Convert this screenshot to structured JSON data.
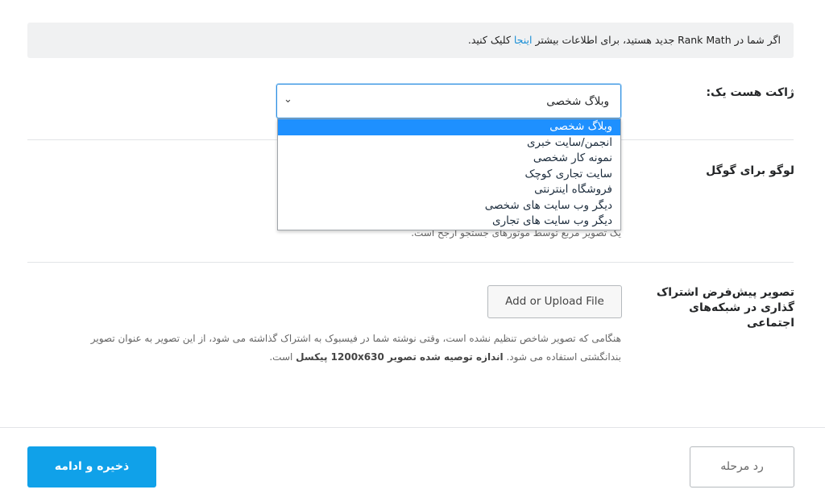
{
  "notice": {
    "before": "اگر شما در Rank Math جدید هستید، برای اطلاعات بیشتر ",
    "link": "اینجا",
    "after": " کلیک کنید."
  },
  "site_type": {
    "label": "ژاکت هست یک:",
    "selected": "وبلاگ شخصی",
    "options": [
      "وبلاگ شخصی",
      "انجمن/سایت خبری",
      "نمونه کار شخصی",
      "سایت تجاری کوچک",
      "فروشگاه اینترنتی",
      "دیگر وب سایت های شخصی",
      "دیگر وب سایت های تجاری"
    ]
  },
  "logo": {
    "label": "لوگو برای گوگل",
    "desc": "یک تصویر مربع توسط موتورهای جستجو ارجح است."
  },
  "social": {
    "label": "تصویر پیش‌فرض اشتراک گذاری در شبکه‌های اجتماعی",
    "button": "Add or Upload File",
    "desc_1": "هنگامی که تصویر شاخص تنظیم نشده است، وقتی نوشته شما در فیسبوک به اشتراک گذاشته می شود، از این تصویر به عنوان تصویر بندانگشتی استفاده می شود. ",
    "desc_bold": "اندازه توصیه شده تصویر 1200x630 پیکسل",
    "desc_2": " است."
  },
  "footer": {
    "save": "ذخیره و ادامه",
    "back": "رد مرحله"
  },
  "colors": {
    "accent": "#10a1e9",
    "link": "#1a8fd6",
    "selected_option": "#1e90ff"
  }
}
